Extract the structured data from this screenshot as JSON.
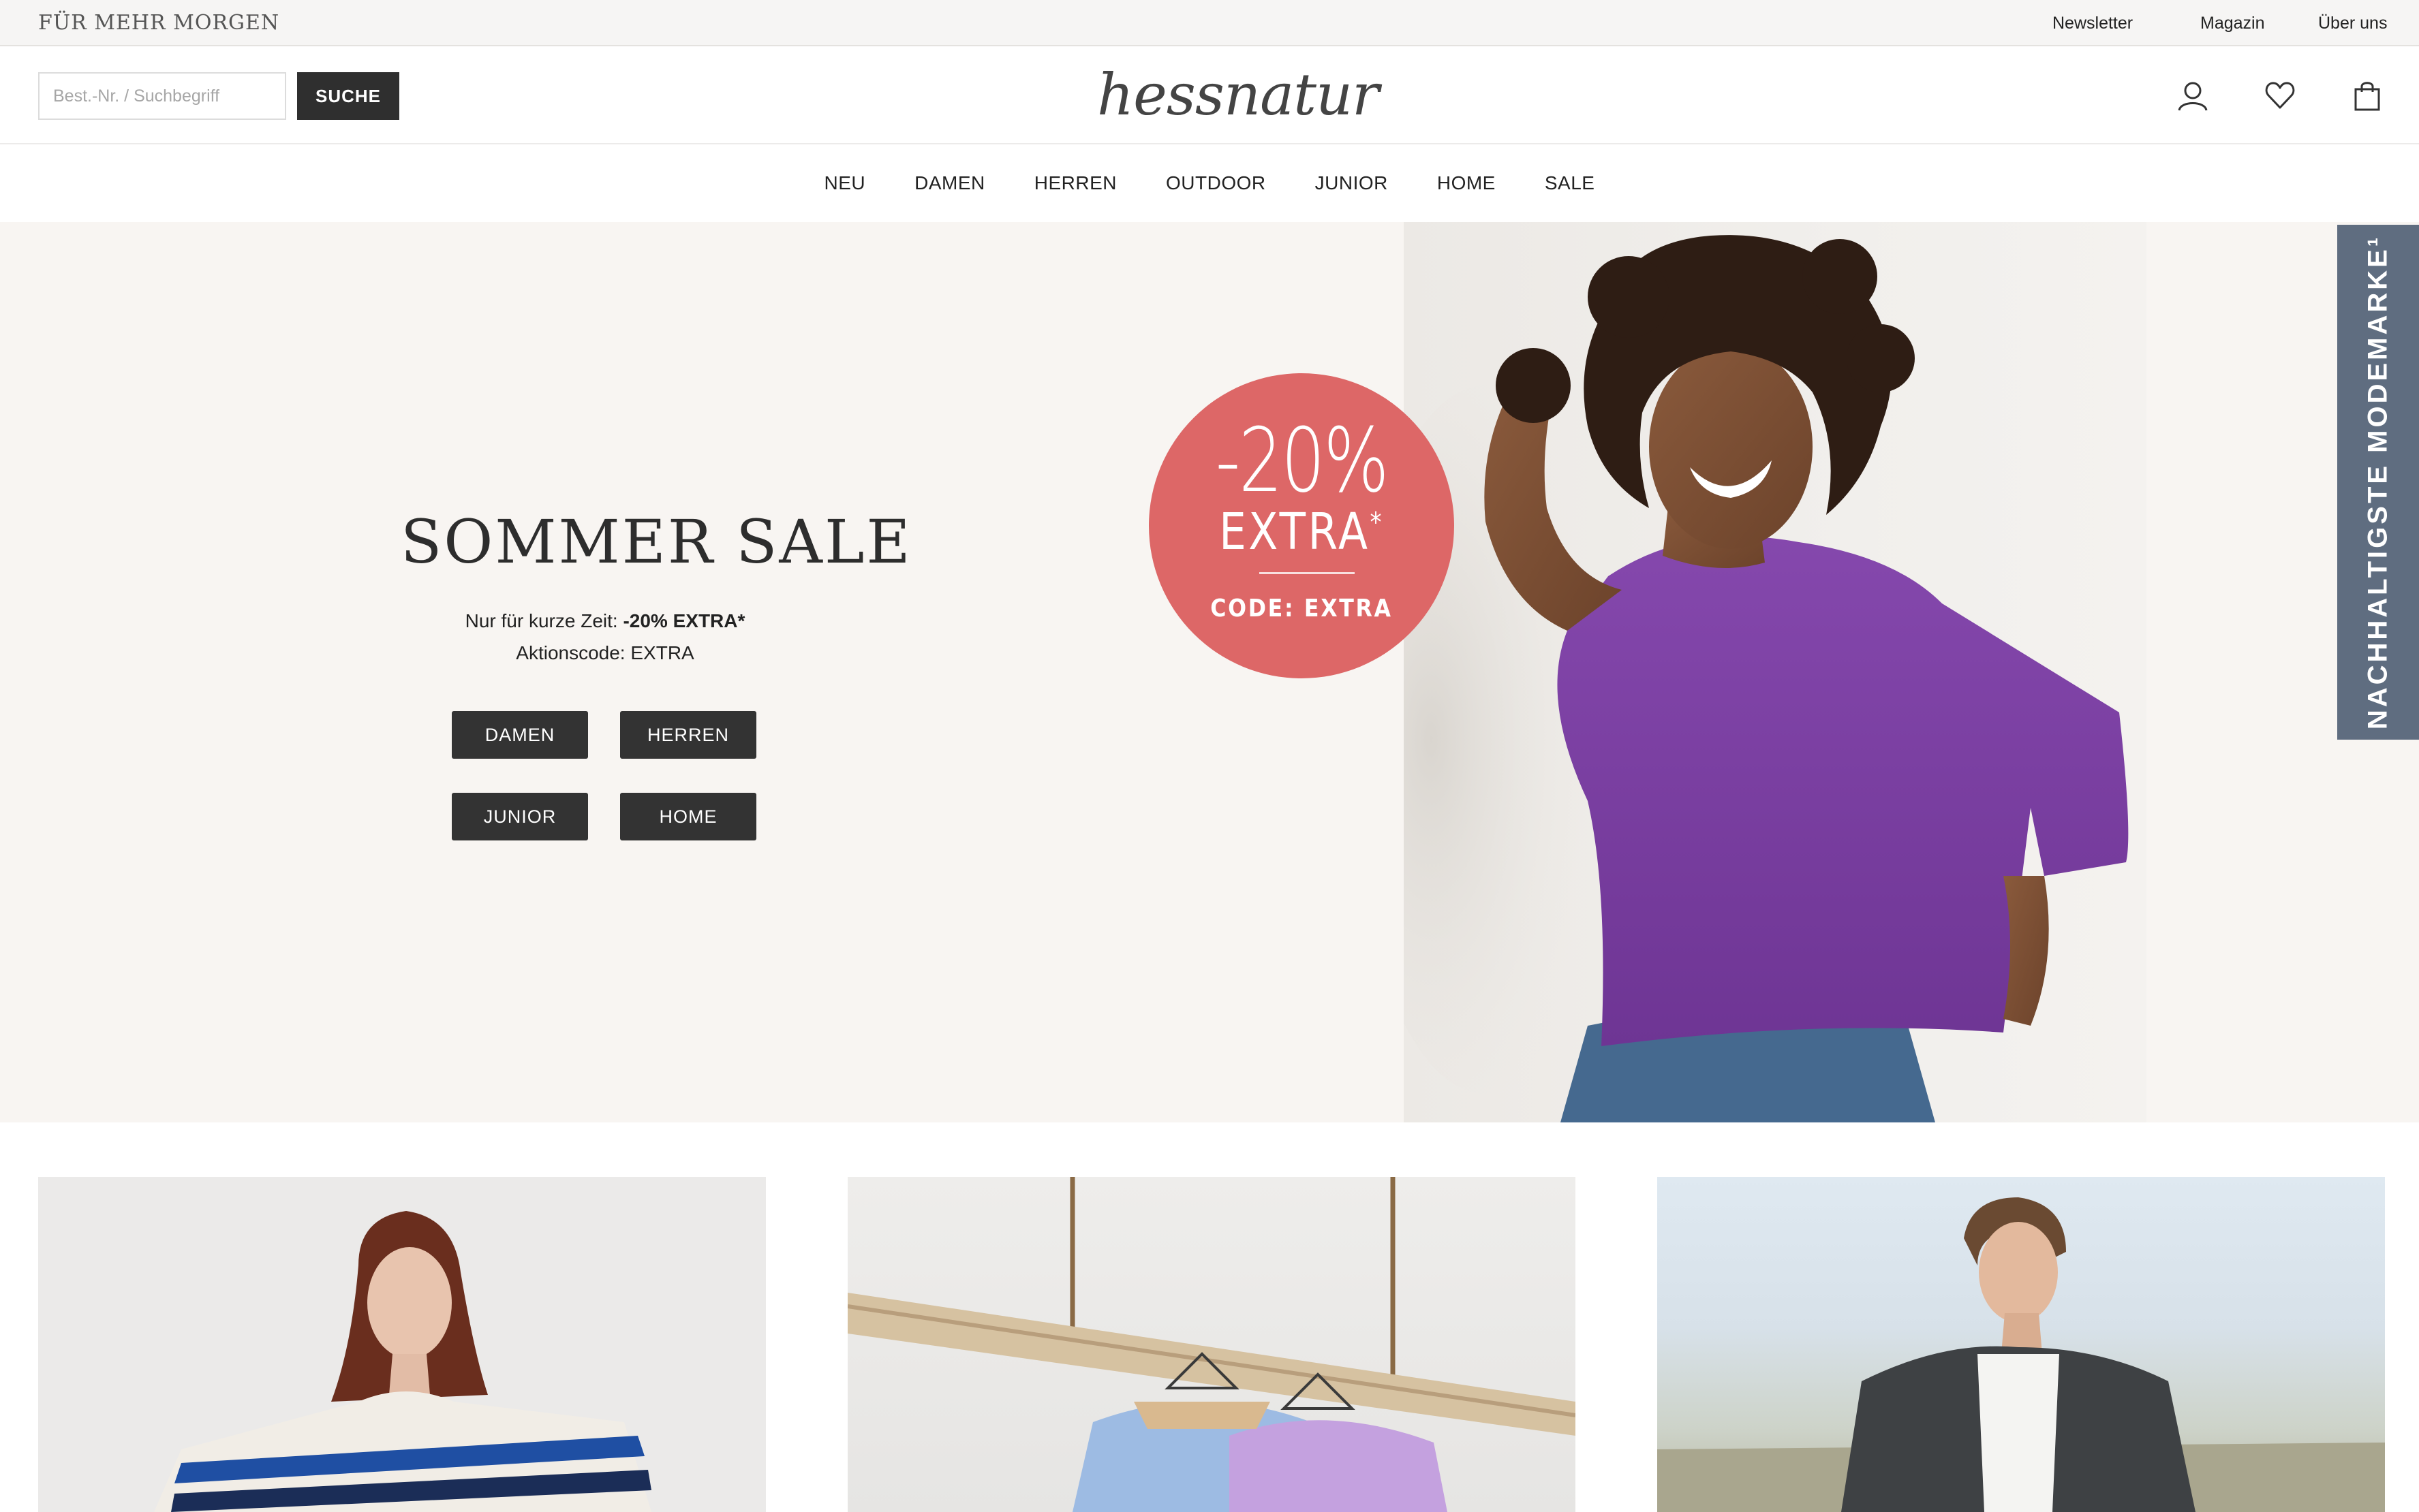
{
  "topbar": {
    "claim": "FÜR MEHR MORGEN",
    "links": [
      "Newsletter",
      "Magazin",
      "Über uns"
    ]
  },
  "header": {
    "search_placeholder": "Best.-Nr. / Suchbegriff",
    "search_button": "SUCHE",
    "logo": "hessnatur",
    "icons": [
      "user-icon",
      "heart-icon",
      "bag-icon"
    ]
  },
  "nav": {
    "items": [
      "NEU",
      "DAMEN",
      "HERREN",
      "OUTDOOR",
      "JUNIOR",
      "HOME",
      "SALE"
    ]
  },
  "hero": {
    "title": "SOMMER SALE",
    "subtitle_prefix": "Nur für kurze Zeit: ",
    "subtitle_bold": "-20% EXTRA*",
    "code_line": "Aktionscode: EXTRA",
    "buttons": [
      "DAMEN",
      "HERREN",
      "JUNIOR",
      "HOME"
    ],
    "badge": {
      "percent": "-20%",
      "extra": "EXTRA",
      "extra_mark": "*",
      "code": "CODE: EXTRA",
      "color": "#dd6767"
    }
  },
  "side_tab": {
    "label": "NACHHALTIGSTE MODEMARKE¹",
    "color": "#5f6d80"
  },
  "colors": {
    "button": "#333333",
    "hero_background": "#f8f5f2",
    "shirt": "#7b3fa0"
  }
}
